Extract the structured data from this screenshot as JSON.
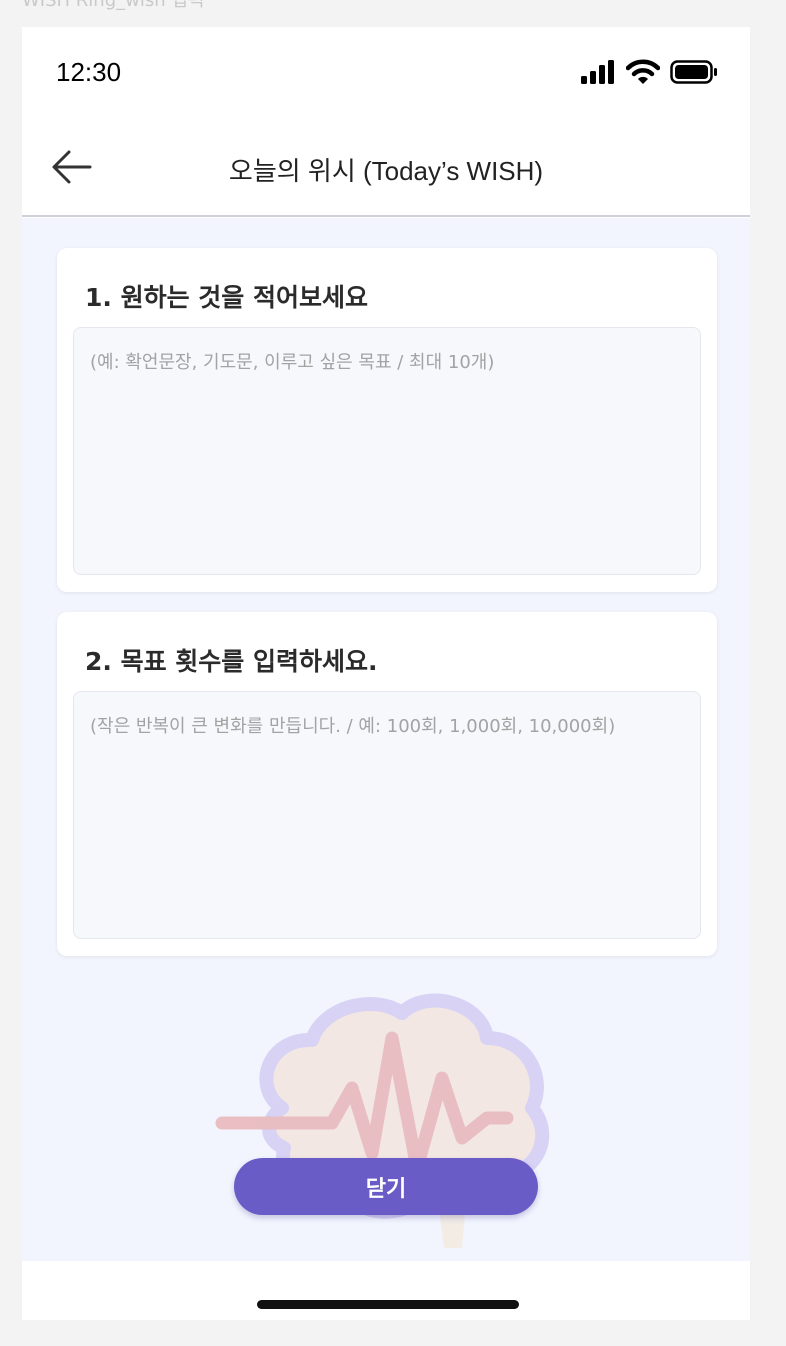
{
  "frame_label": "WISH Ring_wish 입력",
  "status_bar": {
    "time": "12:30",
    "icons": [
      "signal-icon",
      "wifi-icon",
      "battery-icon"
    ]
  },
  "nav": {
    "back_icon": "arrow-left-icon",
    "title": "오늘의 위시 (Today’s WISH)"
  },
  "cards": [
    {
      "title": "1. 원하는 것을 적어보세요",
      "value": "",
      "placeholder": "(예: 확언문장, 기도문, 이루고 싶은 목표 / 최대 10개)"
    },
    {
      "title": "2. 목표 횟수를 입력하세요.",
      "value": "",
      "placeholder": "(작은 반복이 큰 변화를 만듭니다. / 예: 100회, 1,000회, 10,000회)"
    }
  ],
  "illustration": "brain-heartbeat-icon",
  "close_button": {
    "label": "닫기"
  },
  "colors": {
    "accent": "#6a5cc6",
    "content_background": "#f2f5fe",
    "card_input_background": "#f7f8fc"
  }
}
